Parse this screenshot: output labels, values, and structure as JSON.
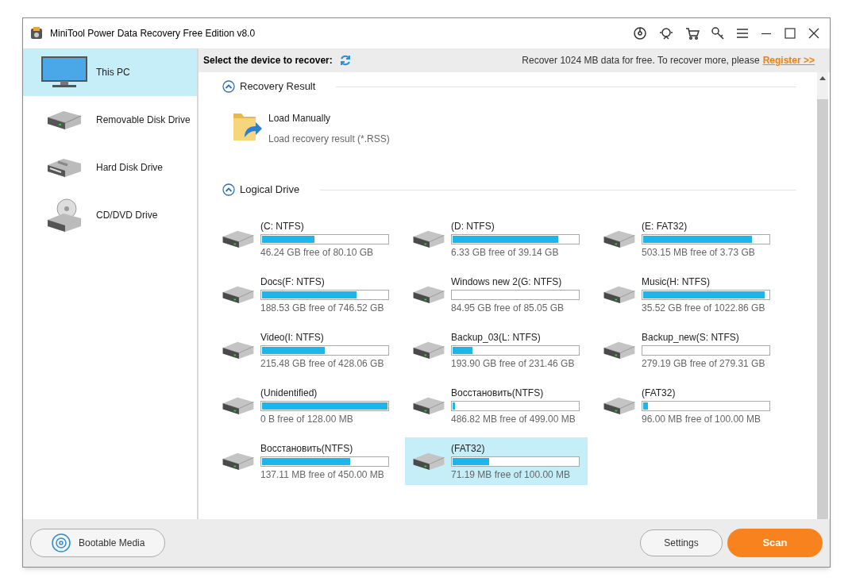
{
  "window": {
    "title": "MiniTool Power Data Recovery Free Edition v8.0"
  },
  "sidebar": {
    "items": [
      {
        "label": "This PC",
        "kind": "monitor",
        "selected": true
      },
      {
        "label": "Removable Disk Drive",
        "kind": "removable",
        "selected": false
      },
      {
        "label": "Hard Disk Drive",
        "kind": "hdd",
        "selected": false
      },
      {
        "label": "CD/DVD Drive",
        "kind": "cd",
        "selected": false
      }
    ]
  },
  "header": {
    "prompt": "Select the device to recover:",
    "notice": "Recover 1024 MB data for free. To recover more, please",
    "link": "Register >>"
  },
  "recovery_result": {
    "title": "Recovery Result",
    "item": {
      "label": "Load Manually",
      "description": "Load recovery result (*.RSS)"
    }
  },
  "logical_drive": {
    "title": "Logical Drive",
    "drives": [
      {
        "name": "(C: NTFS)",
        "free": "46.24 GB free of 80.10 GB",
        "level": 0.42,
        "selected": false
      },
      {
        "name": "(D: NTFS)",
        "free": "6.33 GB free of 39.14 GB",
        "level": 0.84,
        "selected": false
      },
      {
        "name": "(E: FAT32)",
        "free": "503.15 MB free of 3.73 GB",
        "level": 0.87,
        "selected": false
      },
      {
        "name": "Docs(F: NTFS)",
        "free": "188.53 GB free of 746.52 GB",
        "level": 0.75,
        "selected": false
      },
      {
        "name": "Windows new 2(G: NTFS)",
        "free": "84.95 GB free of 85.05 GB",
        "selected": false
      },
      {
        "name": "Music(H: NTFS)",
        "free": "35.52 GB free of 1022.86 GB",
        "level": 0.97,
        "selected": false
      },
      {
        "name": "Video(I: NTFS)",
        "free": "215.48 GB free of 428.06 GB",
        "level": 0.5,
        "selected": false
      },
      {
        "name": "Backup_03(L: NTFS)",
        "free": "193.90 GB free of 231.46 GB",
        "level": 0.16,
        "selected": false
      },
      {
        "name": "Backup_new(S: NTFS)",
        "free": "279.19 GB free of 279.31 GB",
        "selected": false
      },
      {
        "name": "(Unidentified)",
        "free": "0 B free of 128.00 MB",
        "level": 1.0,
        "selected": false
      },
      {
        "name": "Восстановить(NTFS)",
        "free": "486.82 MB free of 499.00 MB",
        "level": 0.02,
        "selected": false
      },
      {
        "name": "(FAT32)",
        "free": "96.00 MB free of 100.00 MB",
        "level": 0.04,
        "selected": false
      },
      {
        "name": "Восстановить(NTFS)",
        "free": "137.11 MB free of 450.00 MB",
        "level": 0.7,
        "selected": false
      },
      {
        "name": "(FAT32)",
        "free": "71.19 MB free of 100.00 MB",
        "level": 0.29,
        "selected": true
      }
    ]
  },
  "footer": {
    "bootable": "Bootable Media",
    "settings": "Settings",
    "scan": "Scan"
  }
}
